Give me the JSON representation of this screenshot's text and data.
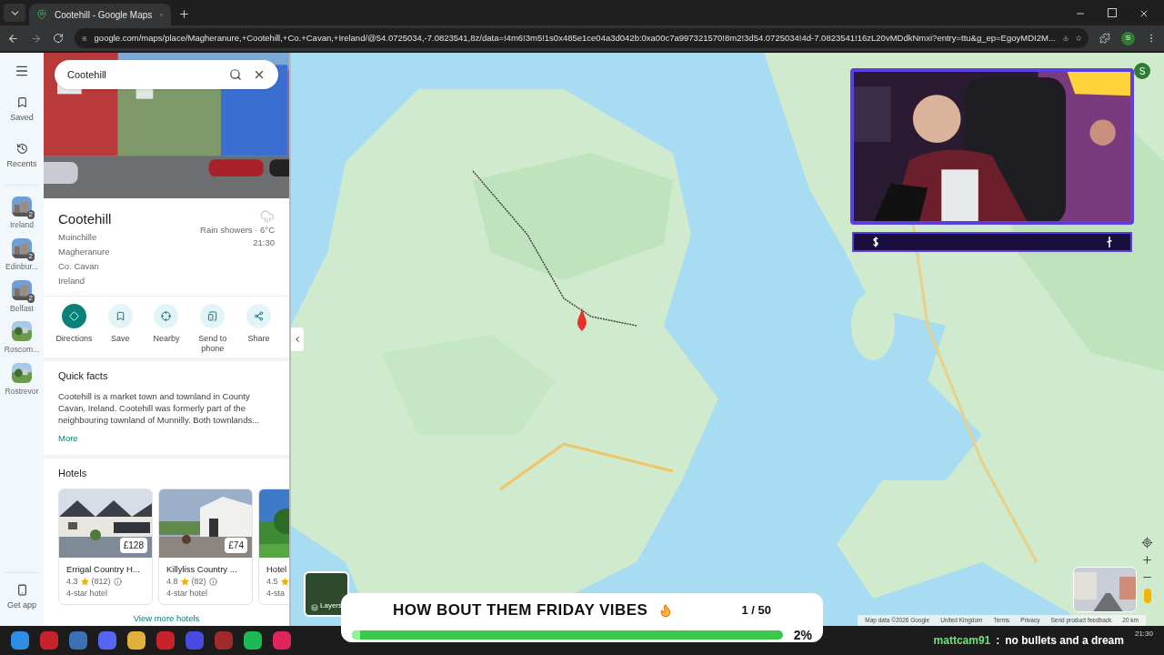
{
  "browser": {
    "tab_title": "Cootehill - Google Maps",
    "url": "google.com/maps/place/Magheranure,+Cootehill,+Co.+Cavan,+Ireland/@54.0725034,-7.0823541,8z/data=!4m6!3m5!1s0x485e1ce04a3d042b:0xa00c7a997321570!8m2!3d54.0725034!4d-7.0823541!16zL20vMDdkNmxi?entry=ttu&g_ep=EgoyMDI2M...",
    "profile": "S"
  },
  "rail": {
    "items": [
      {
        "label": "Saved"
      },
      {
        "label": "Recents"
      }
    ],
    "recent_places": [
      {
        "label": "Ireland",
        "count": "2"
      },
      {
        "label": "Edinbur...",
        "count": "2"
      },
      {
        "label": "Belfast",
        "count": "2"
      },
      {
        "label": "Roscom..."
      },
      {
        "label": "Rostrevor"
      }
    ],
    "get_app": "Get app"
  },
  "search": {
    "value": "Cootehill"
  },
  "place": {
    "name": "Cootehill",
    "address": [
      "Muinchille",
      "Magheranure",
      "Co. Cavan",
      "Ireland"
    ],
    "weather": "Rain showers · 6°C",
    "weather_time": "21:30"
  },
  "actions": [
    {
      "label": "Directions",
      "primary": true
    },
    {
      "label": "Save",
      "primary": false
    },
    {
      "label": "Nearby",
      "primary": false
    },
    {
      "label": "Send to phone",
      "primary": false
    },
    {
      "label": "Share",
      "primary": false
    }
  ],
  "quick_facts": {
    "title": "Quick facts",
    "text": "Cootehill is a market town and townland in County Cavan, Ireland. Cootehill was formerly part of the neighbouring townland of Munnilly. Both townlands...",
    "more": "More"
  },
  "hotels": {
    "title": "Hotels",
    "items": [
      {
        "name": "Errigal Country H...",
        "price": "£128",
        "rating": "4.3",
        "reviews": "(812)",
        "type": "4-star hotel"
      },
      {
        "name": "Killyliss Country ...",
        "price": "£74",
        "rating": "4.8",
        "reviews": "(82)",
        "type": "4-star hotel"
      },
      {
        "name": "Hotel",
        "rating": "4.5",
        "type": "4-sta"
      }
    ],
    "more": "View more hotels"
  },
  "map": {
    "account": "S",
    "layers": "Layers",
    "attribution": [
      "Map data ©2026 Google",
      "United Kingdom",
      "Terms",
      "Privacy",
      "Send product feedback"
    ],
    "scale": "20 km"
  },
  "goal": {
    "title": "HOW BOUT THEM FRIDAY VIBES",
    "count": "1 / 50",
    "percent": "2%",
    "level": 0.02
  },
  "taskbar": {
    "chat_user": "mattcam91",
    "chat_sep": ":",
    "chat_message": "no bullets and a dream",
    "clock": "21:30"
  }
}
